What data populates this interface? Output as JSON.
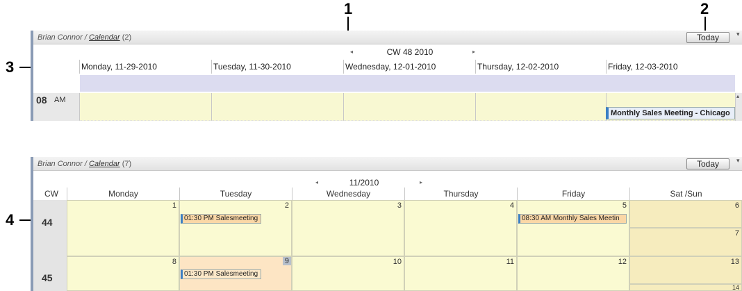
{
  "callouts": [
    "1",
    "2",
    "3",
    "4"
  ],
  "icons": {
    "prev": "◂",
    "next": "▸",
    "menu": "▾",
    "scroll_up": "▴"
  },
  "week_view": {
    "owner": "Brian Connor",
    "separator": "/",
    "calendar_link": "Calendar",
    "count": "(2)",
    "today_label": "Today",
    "nav_label": "CW 48 2010",
    "days": [
      "Monday, 11-29-2010",
      "Tuesday, 11-30-2010",
      "Wednesday, 12-01-2010",
      "Thursday, 12-02-2010",
      "Friday, 12-03-2010"
    ],
    "hour": "08",
    "ampm": "AM",
    "event": "Monthly Sales Meeting - Chicago"
  },
  "month_view": {
    "owner": "Brian Connor",
    "separator": "/",
    "calendar_link": "Calendar",
    "count": "(7)",
    "today_label": "Today",
    "nav_label": "11/2010",
    "cw_header": "CW",
    "days": [
      "Monday",
      "Tuesday",
      "Wednesday",
      "Thursday",
      "Friday",
      "Sat /Sun"
    ],
    "weeks": [
      {
        "cw": "44",
        "dates": [
          "1",
          "2",
          "3",
          "4",
          "5"
        ],
        "sat": "6",
        "sun": "7"
      },
      {
        "cw": "45",
        "dates": [
          "8",
          "9",
          "10",
          "11",
          "12"
        ],
        "sat": "13",
        "sun": "14"
      }
    ],
    "events": {
      "tue_44": "01:30 PM Salesmeeting",
      "fri_44": "08:30 AM Monthly Sales Meetin",
      "tue_45": "01:30 PM Salesmeeting"
    }
  }
}
